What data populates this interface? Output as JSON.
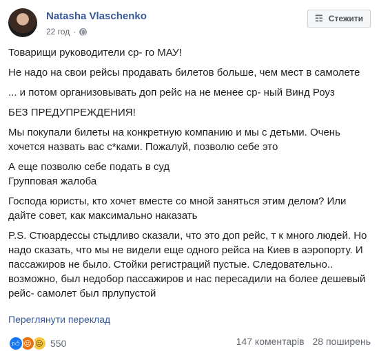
{
  "post": {
    "author": "Natasha Vlaschenko",
    "time": "22 год",
    "dot": "·",
    "follow_label": "Стежити",
    "paragraphs": [
      "Товарищи руководители ср- го МАУ!",
      "Не надо на свои рейсы продавать билетов больше, чем мест в самолете",
      "... и потом организовывать доп рейс на не менее ср- ный Винд Роуз",
      "БЕЗ ПРЕДУПРЕЖДЕНИЯ!",
      "Мы покупали билеты на конкретную компанию и мы с детьми. Очень хочется назвать вас с*ками. Пожалуй, позволю себе это",
      "А еще позволю себе подать в суд",
      "Групповая жалоба",
      "Господа юристы, кто хочет вместе со мной заняться этим делом? Или дайте совет, как максимально наказать",
      "P.S. Стюардессы стыдливо сказали, что это доп рейс, т к много людей. Но надо сказать, что мы не видели еще одного рейса на Киев в аэропорту. И пассажиров не было. Стойки регистраций пустые. Следовательно.. возможно, был недобор пассажиров и нас пересадили на более дешевый рейс- самолет был прлупустой"
    ],
    "translate_link": "Переглянути переклад",
    "reaction_icons": [
      "like-icon",
      "angry-icon",
      "sad-icon"
    ],
    "reaction_count": "550",
    "comments": "147 коментарів",
    "shares": "28 поширень"
  }
}
